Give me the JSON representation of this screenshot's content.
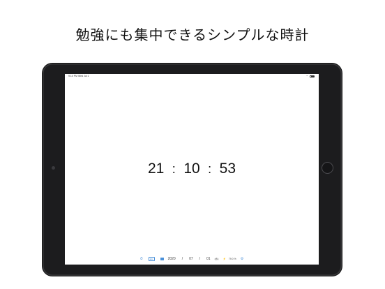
{
  "headline": "勉強にも集中できるシンプルな時計",
  "statusbar": {
    "time_date": "9:10 PM  Wed Jul 1"
  },
  "clock": {
    "hours": "21",
    "minutes": "10",
    "seconds": "53",
    "separator": ":"
  },
  "toolbar": {
    "timer_icon": "⏱",
    "abc_label": "abc",
    "year": "2020",
    "month": "07",
    "day": "01",
    "date_separator": "/",
    "weekday": "(水)",
    "battery_level": "79.0 %",
    "settings_icon": "⚙"
  }
}
